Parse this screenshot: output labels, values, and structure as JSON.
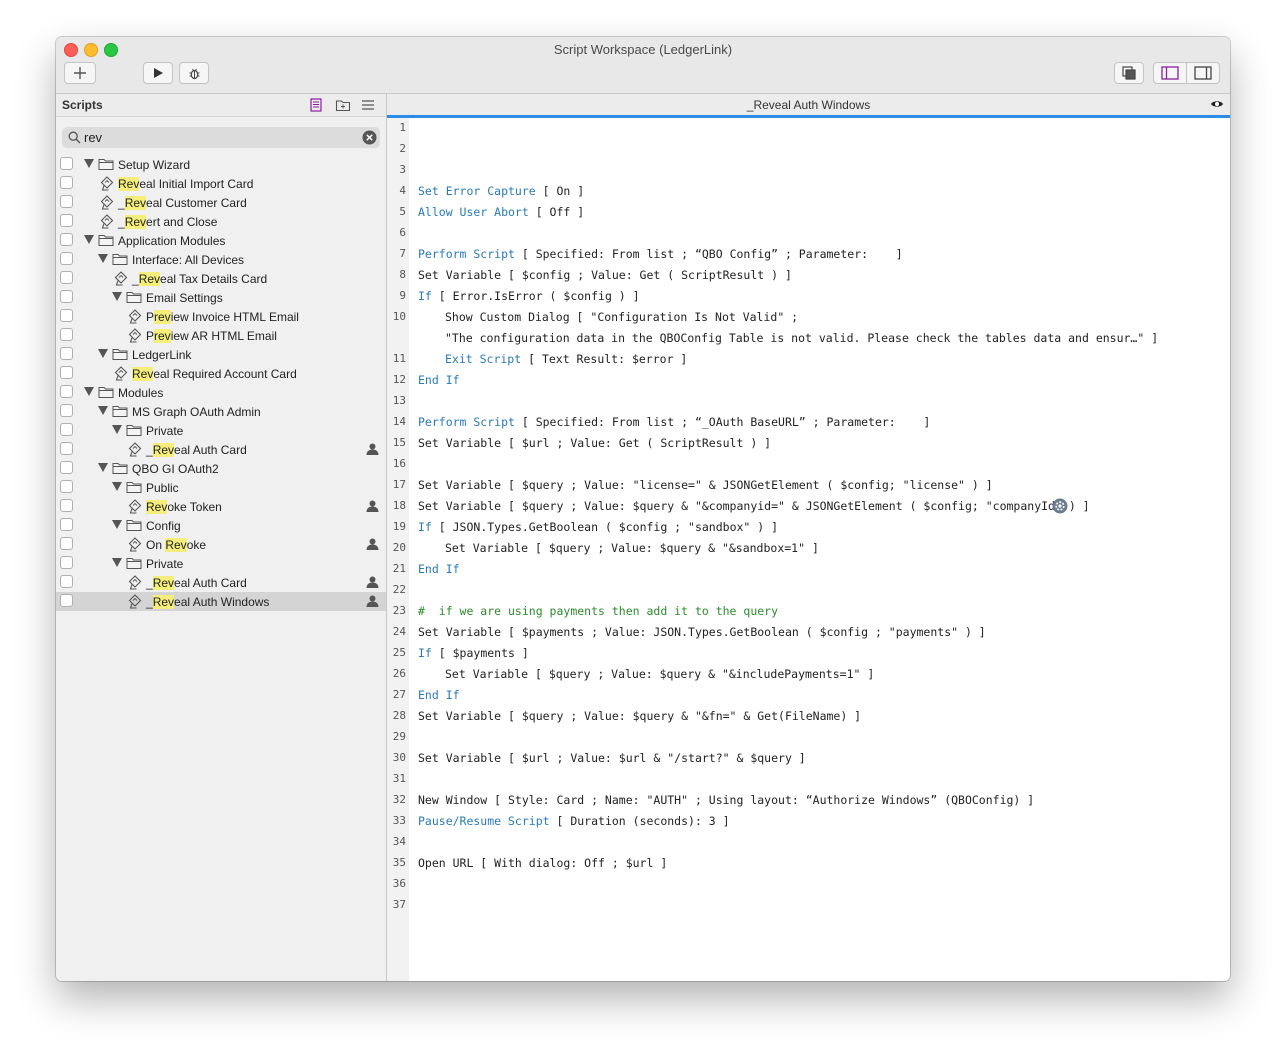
{
  "window": {
    "title": "Script Workspace (LedgerLink)"
  },
  "toolbar": {
    "buttons": [
      "add-icon",
      "run-icon",
      "debug-icon",
      "duplicate-icon",
      "sidebar-left-icon",
      "sidebar-right-icon"
    ]
  },
  "sidebar": {
    "title": "Scripts",
    "search_value": "rev",
    "tree": [
      {
        "level": 0,
        "type": "folder",
        "pre": "",
        "hl": "",
        "post": "Setup Wizard"
      },
      {
        "level": 1,
        "type": "script",
        "pre": "",
        "hl": "Rev",
        "post": "eal Initial Import Card"
      },
      {
        "level": 1,
        "type": "script",
        "pre": "_",
        "hl": "Rev",
        "post": "eal Customer Card"
      },
      {
        "level": 1,
        "type": "script",
        "pre": "_",
        "hl": "Rev",
        "post": "ert and Close"
      },
      {
        "level": 0,
        "type": "folder",
        "pre": "",
        "hl": "",
        "post": "Application Modules"
      },
      {
        "level": 1,
        "type": "folder",
        "pre": "",
        "hl": "",
        "post": "Interface: All Devices"
      },
      {
        "level": 2,
        "type": "script",
        "pre": "_",
        "hl": "Rev",
        "post": "eal Tax Details Card"
      },
      {
        "level": 2,
        "type": "folder",
        "pre": "",
        "hl": "",
        "post": "Email Settings"
      },
      {
        "level": 3,
        "type": "script",
        "pre": "P",
        "hl": "rev",
        "post": "iew Invoice HTML Email"
      },
      {
        "level": 3,
        "type": "script",
        "pre": "P",
        "hl": "rev",
        "post": "iew AR HTML Email"
      },
      {
        "level": 1,
        "type": "folder",
        "pre": "",
        "hl": "",
        "post": "LedgerLink"
      },
      {
        "level": 2,
        "type": "script",
        "pre": "",
        "hl": "Rev",
        "post": "eal Required Account Card"
      },
      {
        "level": 0,
        "type": "folder",
        "pre": "",
        "hl": "",
        "post": "Modules"
      },
      {
        "level": 1,
        "type": "folder",
        "pre": "",
        "hl": "",
        "post": "MS Graph OAuth Admin"
      },
      {
        "level": 2,
        "type": "folder",
        "pre": "",
        "hl": "",
        "post": "Private"
      },
      {
        "level": 3,
        "type": "script",
        "pre": "_",
        "hl": "Rev",
        "post": "eal Auth Card",
        "user": true
      },
      {
        "level": 1,
        "type": "folder",
        "pre": "",
        "hl": "",
        "post": "QBO GI OAuth2"
      },
      {
        "level": 2,
        "type": "folder",
        "pre": "",
        "hl": "",
        "post": "Public"
      },
      {
        "level": 3,
        "type": "script",
        "pre": "",
        "hl": "Rev",
        "post": "oke Token",
        "user": true
      },
      {
        "level": 2,
        "type": "folder",
        "pre": "",
        "hl": "",
        "post": "Config"
      },
      {
        "level": 3,
        "type": "script",
        "pre": "On ",
        "hl": "Rev",
        "post": "oke",
        "user": true
      },
      {
        "level": 2,
        "type": "folder",
        "pre": "",
        "hl": "",
        "post": "Private"
      },
      {
        "level": 3,
        "type": "script",
        "pre": "_",
        "hl": "Rev",
        "post": "eal Auth Card",
        "user": true
      },
      {
        "level": 3,
        "type": "script",
        "pre": "_",
        "hl": "Rev",
        "post": "eal Auth Windows",
        "user": true,
        "selected": true
      }
    ]
  },
  "editor": {
    "tab_title": "_Reveal Auth Windows",
    "lines": [
      {
        "n": "1",
        "indent": 0,
        "kw": "",
        "rest": ""
      },
      {
        "n": "2",
        "indent": 0,
        "kw": "",
        "rest": ""
      },
      {
        "n": "3",
        "indent": 0,
        "kw": "",
        "rest": ""
      },
      {
        "n": "4",
        "indent": 0,
        "kw": "Set Error Capture",
        "rest": " [ On ]"
      },
      {
        "n": "5",
        "indent": 0,
        "kw": "Allow User Abort",
        "rest": " [ Off ]"
      },
      {
        "n": "6",
        "indent": 0,
        "kw": "",
        "rest": ""
      },
      {
        "n": "7",
        "indent": 0,
        "kw": "Perform Script",
        "rest": " [ Specified: From list ; “QBO Config” ; Parameter:    ]"
      },
      {
        "n": "8",
        "indent": 0,
        "kw": "",
        "rest": "Set Variable [ $config ; Value: Get ( ScriptResult ) ]"
      },
      {
        "n": "9",
        "indent": 0,
        "kw": "If",
        "rest": " [ Error.IsError ( $config ) ]"
      },
      {
        "n": "10",
        "indent": 1,
        "kw": "",
        "rest": "Show Custom Dialog [ \"Configuration Is Not Valid\" ;"
      },
      {
        "n": "",
        "indent": 1,
        "kw": "",
        "rest": "\"The configuration data in the QBOConfig Table is not valid. Please check the tables data and ensur…\" ]"
      },
      {
        "n": "11",
        "indent": 1,
        "kw": "Exit Script",
        "rest": " [ Text Result: $error ]"
      },
      {
        "n": "12",
        "indent": 0,
        "kw": "End If",
        "rest": ""
      },
      {
        "n": "13",
        "indent": 0,
        "kw": "",
        "rest": ""
      },
      {
        "n": "14",
        "indent": 0,
        "kw": "Perform Script",
        "rest": " [ Specified: From list ; “_OAuth BaseURL” ; Parameter:    ]"
      },
      {
        "n": "15",
        "indent": 0,
        "kw": "",
        "rest": "Set Variable [ $url ; Value: Get ( ScriptResult ) ]"
      },
      {
        "n": "16",
        "indent": 0,
        "kw": "",
        "rest": ""
      },
      {
        "n": "17",
        "indent": 0,
        "kw": "",
        "rest": "Set Variable [ $query ; Value: \"license=\" & JSONGetElement ( $config; \"license\" ) ]"
      },
      {
        "n": "18",
        "indent": 0,
        "kw": "",
        "rest": "Set Variable [ $query ; Value: $query & \"&companyid=\" & JSONGetElement ( $config; \"companyId\" ) ]",
        "gear": true
      },
      {
        "n": "19",
        "indent": 0,
        "kw": "If",
        "rest": " [ JSON.Types.GetBoolean ( $config ; \"sandbox\" ) ]"
      },
      {
        "n": "20",
        "indent": 1,
        "kw": "",
        "rest": "Set Variable [ $query ; Value: $query & \"&sandbox=1\" ]"
      },
      {
        "n": "21",
        "indent": 0,
        "kw": "End If",
        "rest": ""
      },
      {
        "n": "22",
        "indent": 0,
        "kw": "",
        "rest": ""
      },
      {
        "n": "23",
        "indent": 0,
        "kw": "",
        "rest": "",
        "comment": "#  if we are using payments then add it to the query"
      },
      {
        "n": "24",
        "indent": 0,
        "kw": "",
        "rest": "Set Variable [ $payments ; Value: JSON.Types.GetBoolean ( $config ; \"payments\" ) ]"
      },
      {
        "n": "25",
        "indent": 0,
        "kw": "If",
        "rest": " [ $payments ]"
      },
      {
        "n": "26",
        "indent": 1,
        "kw": "",
        "rest": "Set Variable [ $query ; Value: $query & \"&includePayments=1\" ]"
      },
      {
        "n": "27",
        "indent": 0,
        "kw": "End If",
        "rest": ""
      },
      {
        "n": "28",
        "indent": 0,
        "kw": "",
        "rest": "Set Variable [ $query ; Value: $query & \"&fn=\" & Get(FileName) ]"
      },
      {
        "n": "29",
        "indent": 0,
        "kw": "",
        "rest": ""
      },
      {
        "n": "30",
        "indent": 0,
        "kw": "",
        "rest": "Set Variable [ $url ; Value: $url & \"/start?\" & $query ]"
      },
      {
        "n": "31",
        "indent": 0,
        "kw": "",
        "rest": ""
      },
      {
        "n": "32",
        "indent": 0,
        "kw": "",
        "rest": "New Window [ Style: Card ; Name: \"AUTH\" ; Using layout: “Authorize Windows” (QBOConfig) ]"
      },
      {
        "n": "33",
        "indent": 0,
        "kw": "Pause/Resume Script",
        "rest": " [ Duration (seconds): 3 ]"
      },
      {
        "n": "34",
        "indent": 0,
        "kw": "",
        "rest": ""
      },
      {
        "n": "35",
        "indent": 0,
        "kw": "",
        "rest": "Open URL [ With dialog: Off ; $url ]"
      },
      {
        "n": "36",
        "indent": 0,
        "kw": "",
        "rest": ""
      },
      {
        "n": "37",
        "indent": 0,
        "kw": "",
        "rest": ""
      }
    ]
  }
}
